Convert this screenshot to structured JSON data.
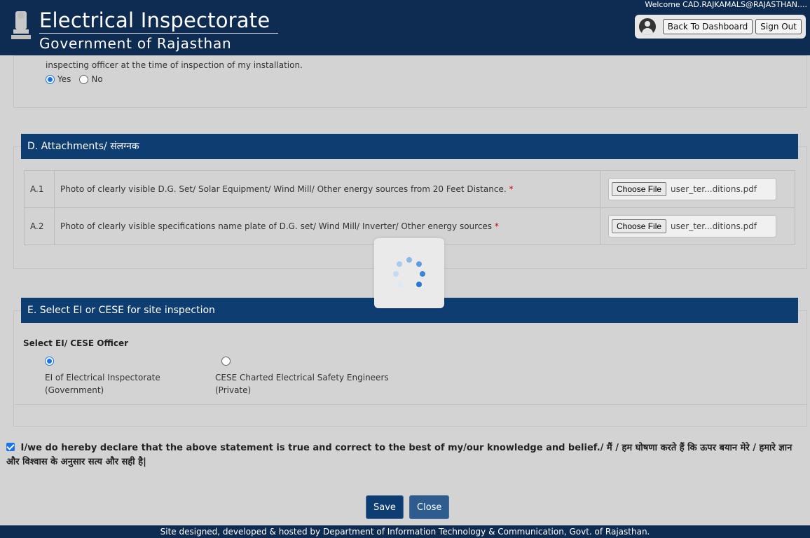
{
  "header": {
    "title": "Electrical Inspectorate",
    "subtitle": "Government of Rajasthan",
    "welcome": "Welcome CAD.RAJKAMALS@RAJASTHAN....",
    "back_button": "Back To Dashboard",
    "signout_button": "Sign Out"
  },
  "top_section": {
    "text": "inspecting officer at the time of inspection of my installation.",
    "yes_label": "Yes",
    "no_label": "No"
  },
  "attachments": {
    "title": "D. Attachments/ संलग्नक",
    "rows": [
      {
        "id": "A.1",
        "desc": "Photo of clearly visible D.G. Set/ Solar Equipment/ Wind Mill/ Other energy sources from 20 Feet Distance.",
        "button": "Choose File",
        "filename": "user_ter...ditions.pdf"
      },
      {
        "id": "A.2",
        "desc": "Photo of clearly visible specifications name plate of D.G. set/ Wind Mill/ Inverter/ Other energy sources",
        "button": "Choose File",
        "filename": "user_ter...ditions.pdf"
      }
    ],
    "required_mark": "*"
  },
  "inspection": {
    "title": "E. Select EI or CESE for site inspection",
    "select_label": "Select EI/ CESE Officer",
    "option1_line1": "EI of Electrical Inspectorate",
    "option1_line2": "(Government)",
    "option2_line1": "CESE Charted Electrical Safety Engineers",
    "option2_line2": "(Private)"
  },
  "declaration": {
    "text": "I/we do hereby declare that the above statement is true and correct to the best of my/our knowledge and belief./ मैं / हम घोषणा करते हैं कि ऊपर बयान मेरे / हमारे ज्ञान और विश्वास के अनुसार सत्य और सही है|"
  },
  "buttons": {
    "save": "Save",
    "close": "Close"
  },
  "footer": {
    "text": "Site designed, developed & hosted by Department of Information Technology & Communication, Govt. of Rajasthan."
  },
  "colors": {
    "header_bg": "#0e2b52",
    "section_bg": "#0e3d72",
    "accent": "#1a73e8"
  }
}
